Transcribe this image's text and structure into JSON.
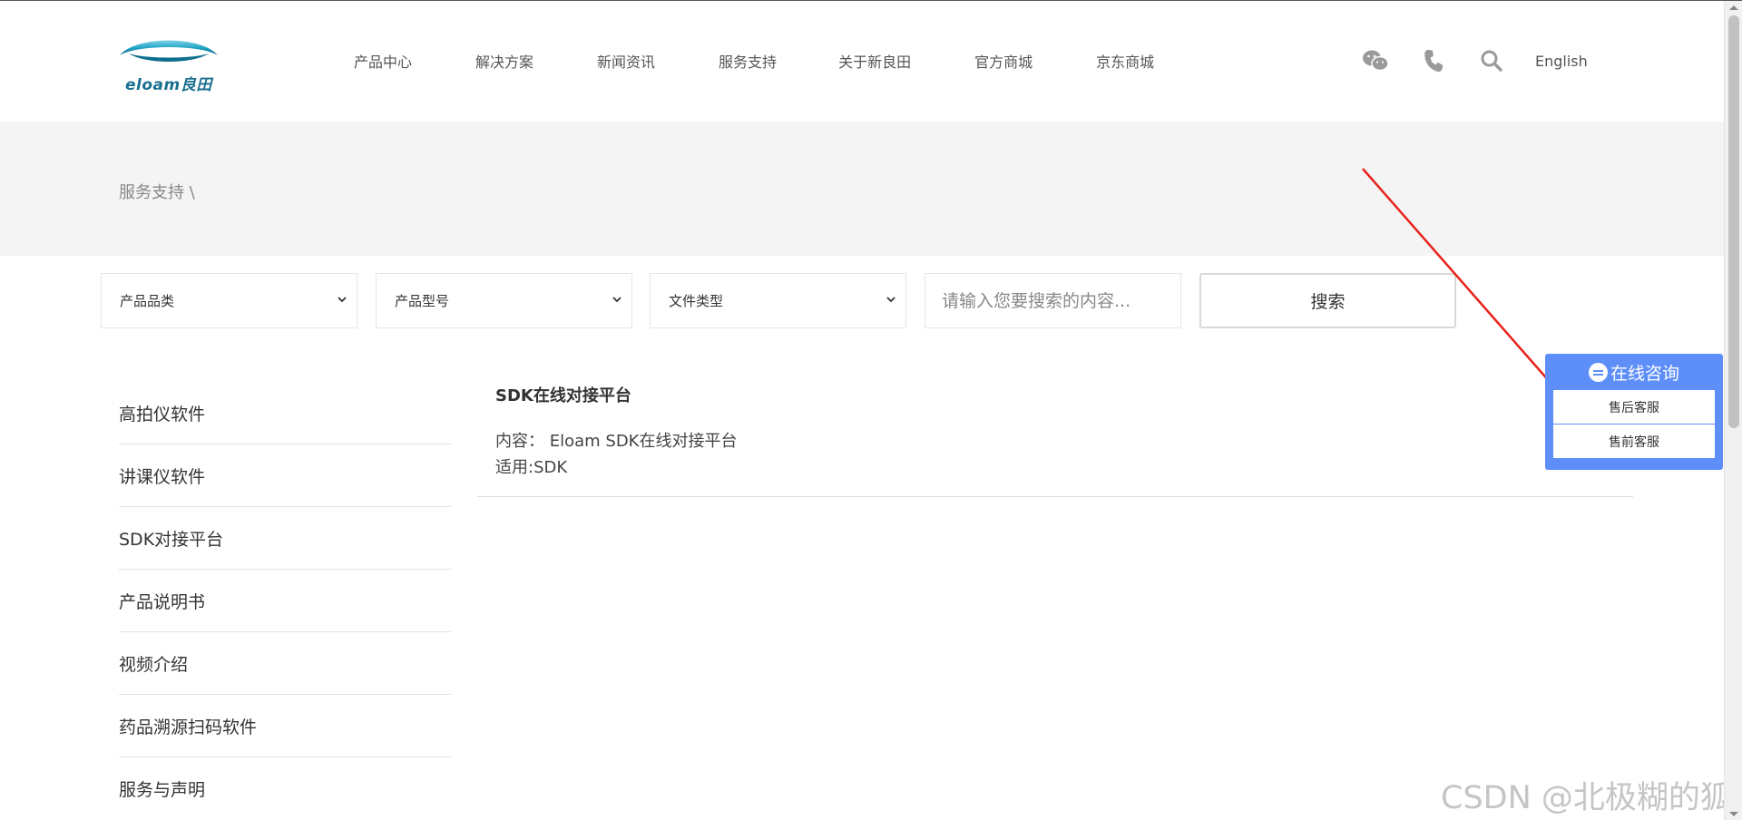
{
  "header": {
    "logo_text": "eloam良田",
    "nav": [
      "产品中心",
      "解决方案",
      "新闻资讯",
      "服务支持",
      "关于新良田",
      "官方商城",
      "京东商城"
    ],
    "tools": {
      "wechat_icon": "wechat-icon",
      "phone_icon": "phone-icon",
      "search_icon": "search-icon",
      "language": "English"
    }
  },
  "breadcrumb": "服务支持 \\",
  "filters": {
    "category": "产品品类",
    "model": "产品型号",
    "file_type": "文件类型",
    "search_placeholder": "请输入您要搜索的内容...",
    "search_button": "搜索"
  },
  "sidebar": {
    "items": [
      "高拍仪软件",
      "讲课仪软件",
      "SDK对接平台",
      "产品说明书",
      "视频介绍",
      "药品溯源扫码软件",
      "服务与声明"
    ]
  },
  "result": {
    "title": "SDK在线对接平台",
    "content": "内容：  Eloam SDK在线对接平台",
    "applies": "适用:SDK"
  },
  "consult": {
    "title": "在线咨询",
    "items": [
      "售后客服",
      "售前客服"
    ]
  },
  "watermark": "CSDN @北极糊的狐",
  "colors": {
    "consult_blue": "#5e8ef7",
    "banner_gray": "#f4f4f4",
    "arrow_red": "#e8221b",
    "logo_teal": "#1a7c9a"
  }
}
